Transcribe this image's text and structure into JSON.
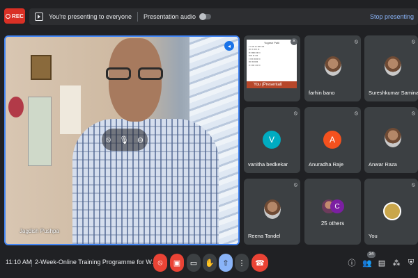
{
  "topbar": {
    "rec_label": "REC",
    "presenting_text": "You're presenting to everyone",
    "audio_label": "Presentation audio",
    "stop_label": "Stop presenting"
  },
  "main_video": {
    "name": "Jagdish Pushpa"
  },
  "tiles": [
    {
      "name": "You",
      "slide_title": "Yogesh Patil",
      "slide_bar": "You (Presentati"
    },
    {
      "name": "farhin bano"
    },
    {
      "name": "Sureshkumar Samina..."
    },
    {
      "name": "vanitha bedkekar",
      "initial": "V",
      "color": "#00acc1"
    },
    {
      "name": "Anuradha Raje",
      "initial": "A",
      "color": "#f4511e"
    },
    {
      "name": "Anwar Raza"
    },
    {
      "name": "Reena Tandel"
    },
    {
      "name": "25 others",
      "initial": "C"
    },
    {
      "name": "You"
    }
  ],
  "bottombar": {
    "time": "11:10 AM",
    "meeting_title": "2-Week-Online Training Programme for W...",
    "participants_count": "34"
  },
  "colors": {
    "accent_blue": "#8ab4f8",
    "record_red": "#d93025",
    "end_call_red": "#ea4335"
  }
}
